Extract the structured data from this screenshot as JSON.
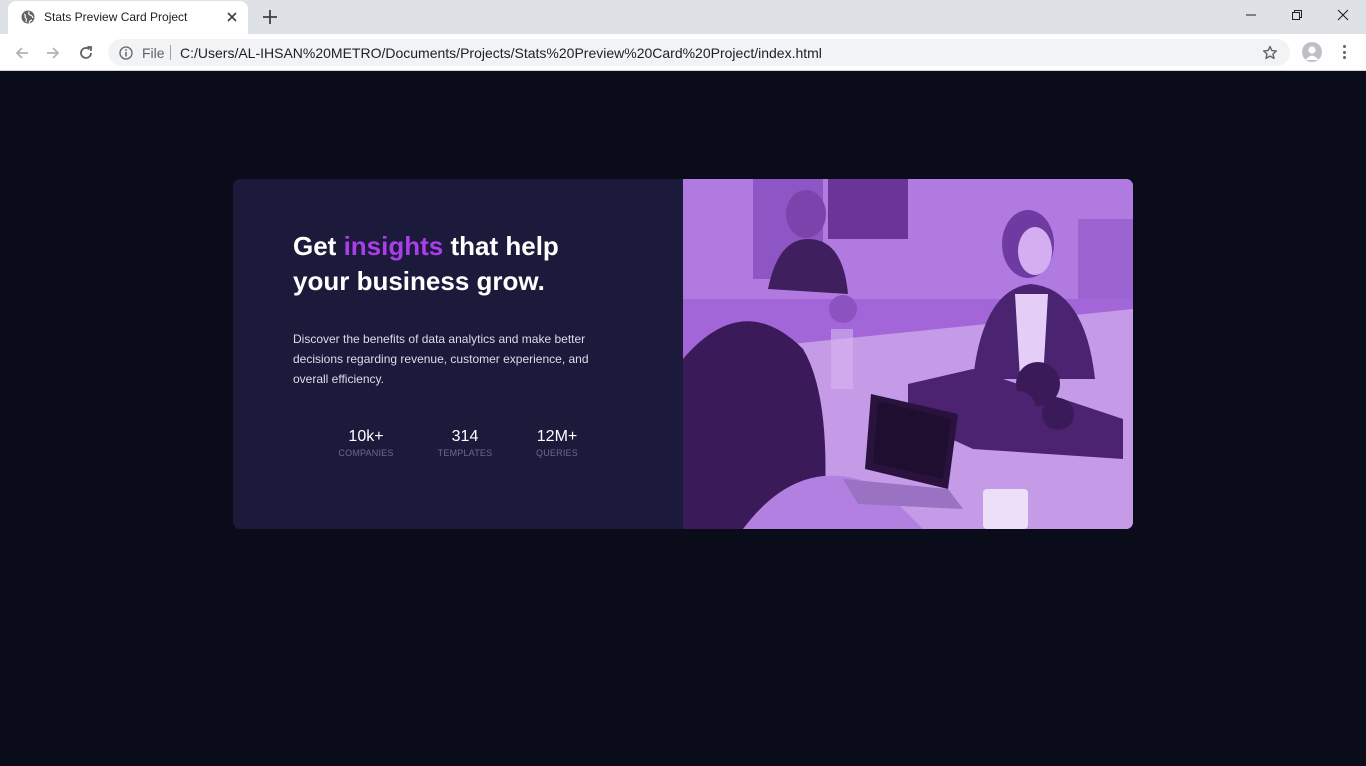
{
  "browser": {
    "tab_title": "Stats Preview Card Project",
    "scheme_label": "File",
    "url": "C:/Users/AL-IHSAN%20METRO/Documents/Projects/Stats%20Preview%20Card%20Project/index.html"
  },
  "card": {
    "headline_start": "Get ",
    "headline_accent": "insights",
    "headline_end": " that help your business grow.",
    "description": "Discover the benefits of data analytics and make better decisions regarding revenue, customer experience, and overall efficiency.",
    "stats": [
      {
        "value": "10k+",
        "label": "COMPANIES"
      },
      {
        "value": "314",
        "label": "TEMPLATES"
      },
      {
        "value": "12M+",
        "label": "QUERIES"
      }
    ]
  },
  "colors": {
    "page_background": "#0a0c1a",
    "card_background": "#1c1a3b",
    "accent": "#a83fe8",
    "image_overlay": "#a366d8"
  }
}
